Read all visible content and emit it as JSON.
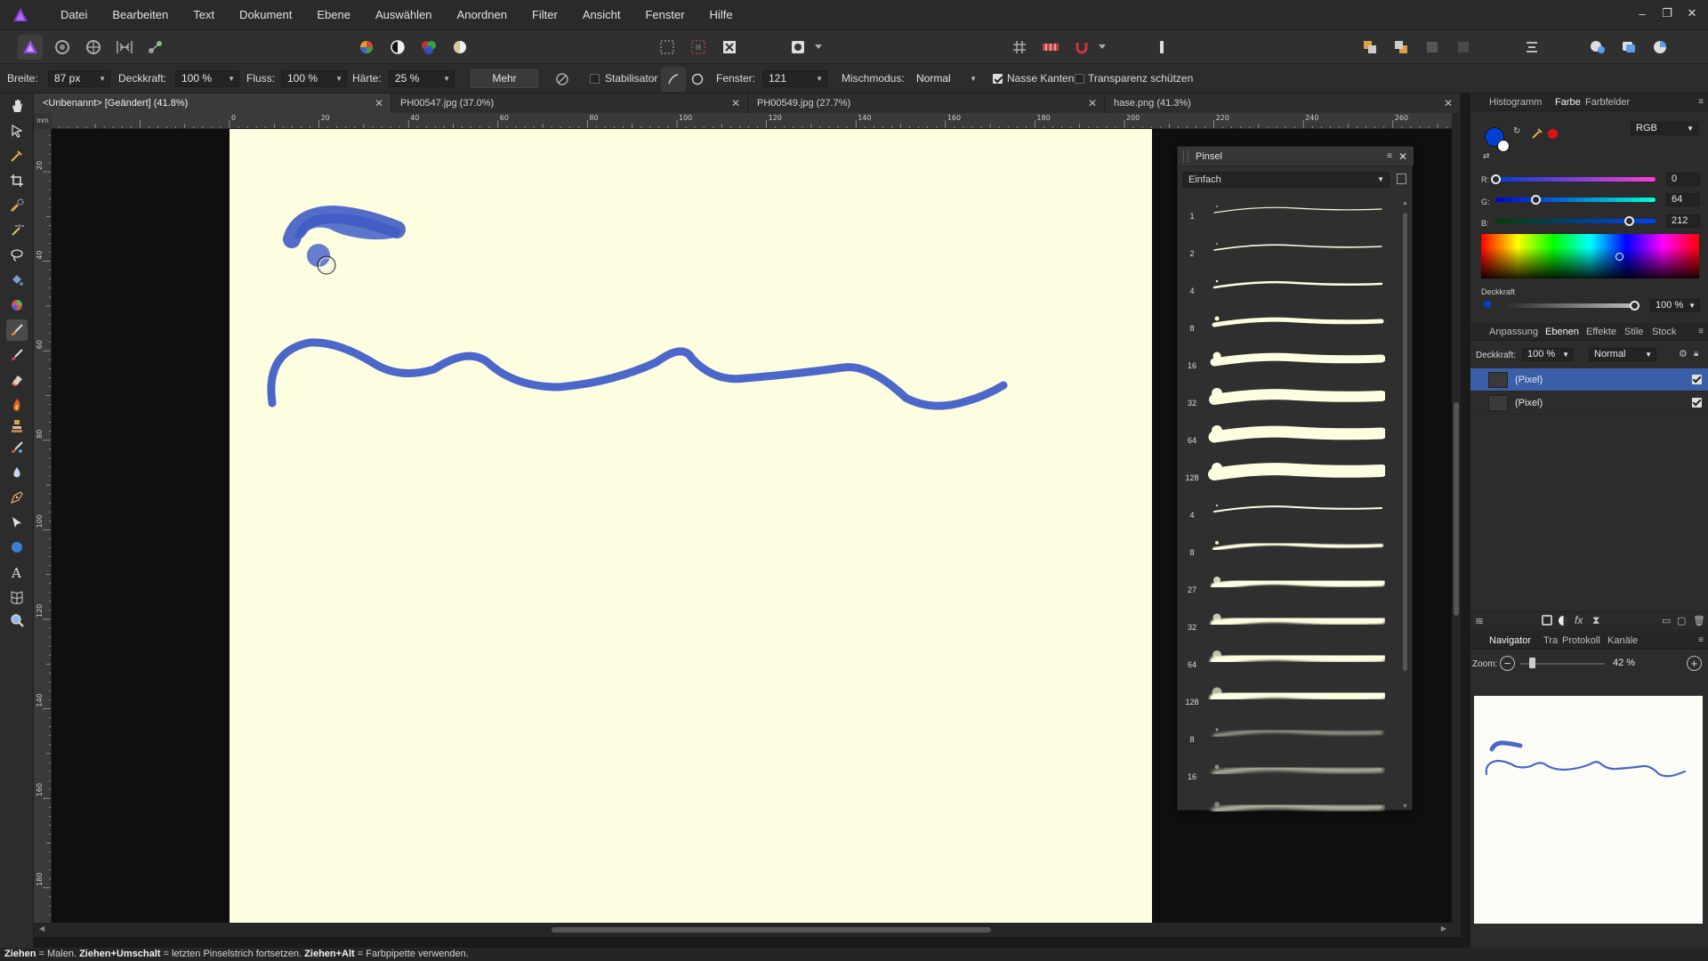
{
  "menu": {
    "items": [
      "Datei",
      "Bearbeiten",
      "Text",
      "Dokument",
      "Ebene",
      "Auswählen",
      "Anordnen",
      "Filter",
      "Ansicht",
      "Fenster",
      "Hilfe"
    ]
  },
  "window_controls": {
    "minimize": "–",
    "restore": "❐",
    "close": "✕"
  },
  "context_bar": {
    "width_label": "Breite:",
    "width_value": "87 px",
    "opacity_label": "Deckkraft:",
    "opacity_value": "100 %",
    "flow_label": "Fluss:",
    "flow_value": "100 %",
    "hardness_label": "Härte:",
    "hardness_value": "25 %",
    "more_label": "Mehr",
    "stabilizer_label": "Stabilisator",
    "window_label": "Fenster:",
    "window_value": "121",
    "blend_label": "Mischmodus:",
    "blend_value": "Normal",
    "wet_edges_label": "Nasse Kanten",
    "protect_alpha_label": "Transparenz schützen"
  },
  "tabs": [
    {
      "label": "<Unbenannt> [Geändert] (41.8%)",
      "close": "✕"
    },
    {
      "label": "PH00547.jpg (37.0%)",
      "close": "✕"
    },
    {
      "label": "PH00549.jpg (27.7%)",
      "close": "✕"
    },
    {
      "label": "hase.png (41.3%)",
      "close": "✕"
    }
  ],
  "rulers": {
    "unit": "mm",
    "top_labels": [
      "0",
      "20",
      "40",
      "60",
      "80",
      "100",
      "120",
      "140",
      "160",
      "180",
      "200",
      "220",
      "240",
      "260"
    ],
    "left_labels": [
      "20",
      "40",
      "60",
      "80",
      "100",
      "120",
      "140",
      "160",
      "180"
    ]
  },
  "brush_panel": {
    "title": "Pinsel",
    "category": "Einfach",
    "brushes": [
      {
        "size": "1",
        "thickness": 1.2,
        "blur": 0
      },
      {
        "size": "2",
        "thickness": 1.6,
        "blur": 0
      },
      {
        "size": "4",
        "thickness": 2.5,
        "blur": 0
      },
      {
        "size": "8",
        "thickness": 5,
        "blur": 0
      },
      {
        "size": "16",
        "thickness": 9,
        "blur": 0
      },
      {
        "size": "32",
        "thickness": 12,
        "blur": 0
      },
      {
        "size": "64",
        "thickness": 13,
        "blur": 0
      },
      {
        "size": "128",
        "thickness": 14,
        "blur": 0
      },
      {
        "size": "4",
        "thickness": 2,
        "blur": 0
      },
      {
        "size": "8",
        "thickness": 4,
        "blur": 0.4
      },
      {
        "size": "27",
        "thickness": 8,
        "blur": 0.8
      },
      {
        "size": "32",
        "thickness": 9,
        "blur": 1
      },
      {
        "size": "64",
        "thickness": 10,
        "blur": 1.2
      },
      {
        "size": "128",
        "thickness": 11,
        "blur": 1.4
      },
      {
        "size": "8",
        "thickness": 3,
        "blur": 1.8
      },
      {
        "size": "16",
        "thickness": 5,
        "blur": 2.2
      },
      {
        "size": "",
        "thickness": 6,
        "blur": 2.5
      }
    ]
  },
  "color_panel": {
    "tabs": [
      "Histogramm",
      "Farbe",
      "Farbfelder"
    ],
    "mode": "RGB",
    "r_label": "R:",
    "r_value": "0",
    "r": 0,
    "g_label": "G:",
    "g_value": "64",
    "g": 64,
    "b_label": "B:",
    "b_value": "212",
    "b": 212,
    "opacity_label": "Deckkraft",
    "opacity_value": "100 %",
    "opacity": 1.0,
    "primary_color": "#0040d4",
    "secondary_color": "#ffffff",
    "accent_swatch": "#e01010"
  },
  "layers_panel": {
    "tabs": [
      "Anpassung",
      "Ebenen",
      "Effekte",
      "Stile",
      "Stock"
    ],
    "opacity_label": "Deckkraft:",
    "opacity_value": "100 %",
    "blend_value": "Normal",
    "layers": [
      {
        "name": "(Pixel)",
        "selected": true
      },
      {
        "name": "(Pixel)",
        "selected": false
      }
    ]
  },
  "navigator_panel": {
    "tabs": [
      "Navigator",
      "Tra",
      "Protokoll",
      "Kanäle"
    ],
    "zoom_label": "Zoom:",
    "zoom_value": "42 %",
    "zoom": 0.42
  },
  "status": {
    "k1": "Ziehen",
    "t1": " = Malen. ",
    "k2": "Ziehen+Umschalt",
    "t2": " = letzten Pinselstrich fortsetzen. ",
    "k3": "Ziehen+Alt",
    "t3": " = Farbpipette verwenden."
  },
  "colors": {
    "stroke": "#4a67c9",
    "canvas_bg": "#fdfde0",
    "selection": "#3a5fa8"
  },
  "icons": {
    "toolbar": [
      "affinity-persona-icon",
      "liquify-persona-icon",
      "develop-persona-icon",
      "tone-mapping-persona-icon",
      "export-persona-icon",
      "color-wheel-icon",
      "contrast-icon",
      "hue-icon",
      "white-balance-icon",
      "marquee-icon",
      "marquee-subtract-icon",
      "invert-selection-icon",
      "mask-icon",
      "grid-icon",
      "snapping-icon",
      "magnet-icon",
      "info-icon",
      "arrange-front-icon",
      "arrange-back-icon",
      "align-icon",
      "user-icon",
      "assistant-icon",
      "color-picker-icon"
    ],
    "tools": [
      "hand-icon",
      "move-icon",
      "color-picker-icon",
      "crop-icon",
      "selection-brush-icon",
      "flood-select-icon",
      "lasso-icon",
      "fill-icon",
      "gradient-icon",
      "paint-brush-icon",
      "color-replacement-icon",
      "erase-icon",
      "burn-icon",
      "clone-icon",
      "healing-icon",
      "blur-icon",
      "pen-icon",
      "node-icon",
      "shape-icon",
      "text-icon",
      "mesh-warp-icon",
      "zoom-icon"
    ]
  }
}
